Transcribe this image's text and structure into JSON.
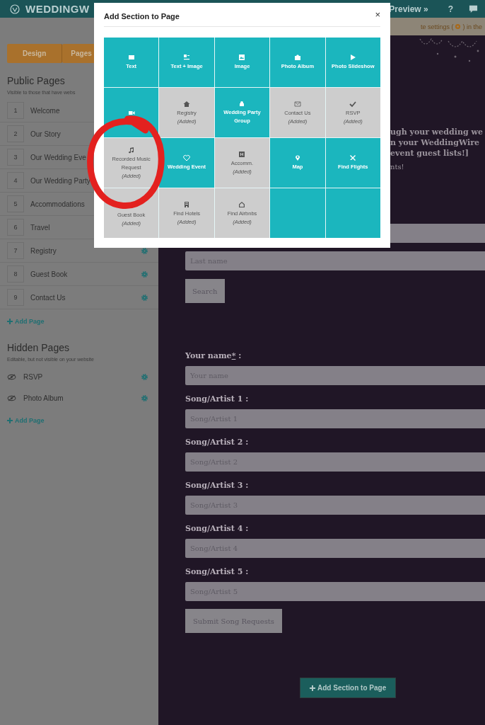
{
  "header": {
    "logo": "WEDDINGW",
    "preview": "Preview »",
    "help": "?"
  },
  "sidebar": {
    "tabs": [
      {
        "label": "Design"
      },
      {
        "label": "Pages"
      }
    ],
    "public": {
      "title": "Public Pages",
      "subtitle": "Visible to those that have webs",
      "items": [
        {
          "number": "1",
          "name": "Welcome",
          "gear": false
        },
        {
          "number": "2",
          "name": "Our Story",
          "gear": false
        },
        {
          "number": "3",
          "name": "Our Wedding Eve",
          "gear": false
        },
        {
          "number": "4",
          "name": "Our Wedding Party",
          "gear": false
        },
        {
          "number": "5",
          "name": "Accommodations",
          "gear": false
        },
        {
          "number": "6",
          "name": "Travel",
          "gear": false
        },
        {
          "number": "7",
          "name": "Registry",
          "gear": true
        },
        {
          "number": "8",
          "name": "Guest Book",
          "gear": true
        },
        {
          "number": "9",
          "name": "Contact Us",
          "gear": true
        }
      ],
      "add": "Add Page"
    },
    "hidden": {
      "title": "Hidden Pages",
      "subtitle": "Editable, but not visible on your website",
      "items": [
        {
          "name": "RSVP",
          "gear": true
        },
        {
          "name": "Photo Album",
          "gear": true
        }
      ],
      "add": "Add Page"
    }
  },
  "main": {
    "notice": "te settings (",
    "notice_end": ") in the",
    "intro": [
      "ugh your wedding we",
      "n your WeddingWire",
      "event guest lists!]"
    ],
    "intro_end": "nts!",
    "last_name": {
      "placeholder": "Last name"
    },
    "search": "Search",
    "form": [
      {
        "label": "Your name",
        "required_mark": "*",
        "suffix": ":",
        "placeholder": "Your name"
      },
      {
        "label": "Song/Artist 1",
        "suffix": ":",
        "placeholder": "Song/Artist 1"
      },
      {
        "label": "Song/Artist 2",
        "suffix": ":",
        "placeholder": "Song/Artist 2"
      },
      {
        "label": "Song/Artist 3",
        "suffix": ":",
        "placeholder": "Song/Artist 3"
      },
      {
        "label": "Song/Artist 4",
        "suffix": ":",
        "placeholder": "Song/Artist 4"
      },
      {
        "label": "Song/Artist 5",
        "suffix": ":",
        "placeholder": "Song/Artist 5"
      }
    ],
    "submit": "Submit Song Requests",
    "add_section": "Add Section to Page"
  },
  "modal": {
    "title": "Add Section to Page",
    "close": "×",
    "tiles": [
      {
        "kind": "available",
        "label": "Text"
      },
      {
        "kind": "available",
        "label": "Text + Image"
      },
      {
        "kind": "available",
        "label": "Image"
      },
      {
        "kind": "available",
        "label": "Photo Album"
      },
      {
        "kind": "available",
        "label": "Photo Slideshow"
      },
      {
        "kind": "available"
      },
      {
        "kind": "added",
        "label": "Registry",
        "note": "(Added)"
      },
      {
        "kind": "available",
        "label": "Wedding Party Group"
      },
      {
        "kind": "added",
        "label": "Contact Us",
        "note": "(Added)"
      },
      {
        "kind": "added",
        "label": "RSVP",
        "note": "(Added)"
      },
      {
        "kind": "added",
        "label": "Recorded Music Request",
        "note": "(Added)"
      },
      {
        "kind": "available",
        "label": "Wedding Event"
      },
      {
        "kind": "added",
        "label": "Accomm.",
        "note": "(Added)"
      },
      {
        "kind": "available",
        "label": "Map"
      },
      {
        "kind": "available",
        "label": "Find Flights"
      },
      {
        "kind": "added",
        "label": "Guest Book",
        "note": "(Added)"
      },
      {
        "kind": "added",
        "label": "Find Hotels",
        "note": "(Added)"
      },
      {
        "kind": "added",
        "label": "Find Airbnbs",
        "note": "(Added)"
      },
      {
        "kind": "blank"
      },
      {
        "kind": "blank"
      }
    ]
  }
}
